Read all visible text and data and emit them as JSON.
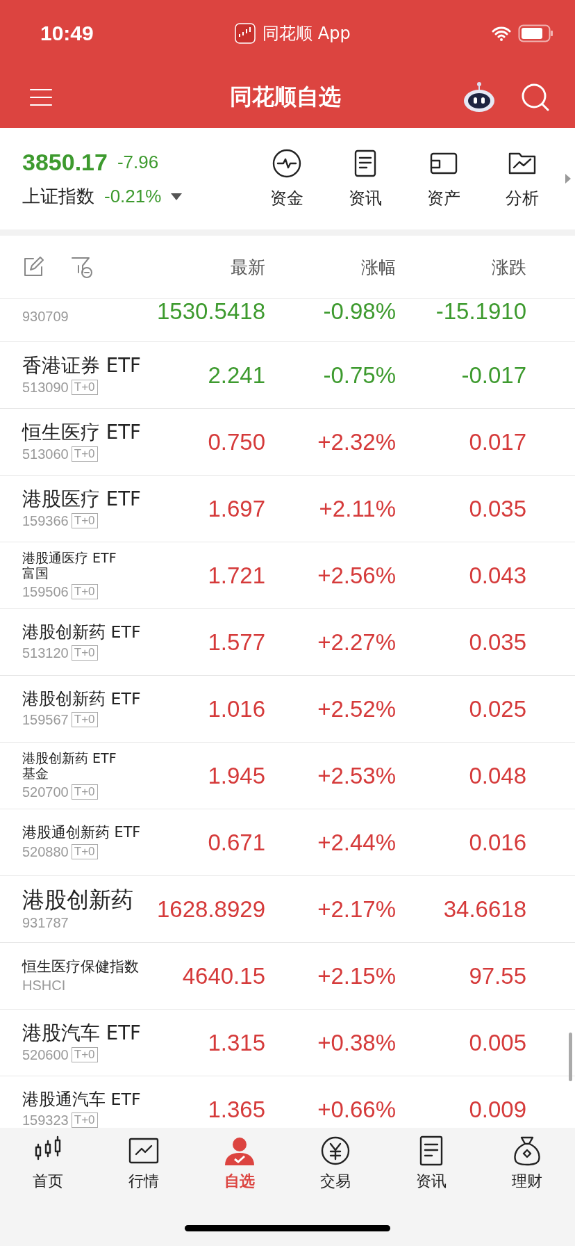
{
  "status_bar": {
    "time": "10:49",
    "app_label": "同花顺 App"
  },
  "header": {
    "title": "同花顺自选"
  },
  "index": {
    "value": "3850.17",
    "change": "-7.96",
    "name": "上证指数",
    "percent": "-0.21%",
    "rising": false
  },
  "shortcuts": [
    {
      "kind": "pulse",
      "label": "资金"
    },
    {
      "kind": "document",
      "label": "资讯"
    },
    {
      "kind": "wallet",
      "label": "资产"
    },
    {
      "kind": "chart",
      "label": "分析"
    }
  ],
  "columns": [
    "最新",
    "涨幅",
    "涨跌"
  ],
  "rows": [
    {
      "code": "930709",
      "price": "1530.5418",
      "percent": "-0.98%",
      "change": "-15.1910",
      "rising": false
    },
    {
      "name": "香港证券 ETF",
      "code": "513090",
      "tag": "T+0",
      "price": "2.241",
      "percent": "-0.75%",
      "change": "-0.017",
      "rising": false
    },
    {
      "name": "恒生医疗 ETF",
      "code": "513060",
      "tag": "T+0",
      "price": "0.750",
      "percent": "+2.32%",
      "change": "0.017",
      "rising": true
    },
    {
      "name": "港股医疗 ETF",
      "code": "159366",
      "tag": "T+0",
      "price": "1.697",
      "percent": "+2.11%",
      "change": "0.035",
      "rising": true
    },
    {
      "name": "港股通医疗 ETF 富国",
      "code": "159506",
      "tag": "T+0",
      "price": "1.721",
      "percent": "+2.56%",
      "change": "0.043",
      "rising": true
    },
    {
      "name": "港股创新药 ETF",
      "code": "513120",
      "tag": "T+0",
      "price": "1.577",
      "percent": "+2.27%",
      "change": "0.035",
      "rising": true
    },
    {
      "name": "港股创新药 ETF",
      "code": "159567",
      "tag": "T+0",
      "price": "1.016",
      "percent": "+2.52%",
      "change": "0.025",
      "rising": true
    },
    {
      "name": "港股创新药 ETF 基金",
      "code": "520700",
      "tag": "T+0",
      "price": "1.945",
      "percent": "+2.53%",
      "change": "0.048",
      "rising": true
    },
    {
      "name": "港股通创新药 ETF",
      "code": "520880",
      "tag": "T+0",
      "price": "0.671",
      "percent": "+2.44%",
      "change": "0.016",
      "rising": true
    },
    {
      "name": "港股创新药",
      "code": "931787",
      "price": "1628.8929",
      "percent": "+2.17%",
      "change": "34.6618",
      "rising": true
    },
    {
      "name": "恒生医疗保健指数",
      "code": "HSHCI",
      "price": "4640.15",
      "percent": "+2.15%",
      "change": "97.55",
      "rising": true
    },
    {
      "name": "港股汽车 ETF",
      "code": "520600",
      "tag": "T+0",
      "price": "1.315",
      "percent": "+0.38%",
      "change": "0.005",
      "rising": true
    },
    {
      "name": "港股通汽车 ETF",
      "code": "159323",
      "tag": "T+0",
      "price": "1.365",
      "percent": "+0.66%",
      "change": "0.009",
      "rising": true
    }
  ],
  "tab_bar": [
    {
      "kind": "candles",
      "label": "首页",
      "selected": false
    },
    {
      "kind": "chart",
      "label": "行情",
      "selected": false
    },
    {
      "kind": "person",
      "label": "自选",
      "selected": true
    },
    {
      "kind": "yen",
      "label": "交易",
      "selected": false
    },
    {
      "kind": "document",
      "label": "资讯",
      "selected": false
    },
    {
      "kind": "bag",
      "label": "理财",
      "selected": false
    }
  ]
}
